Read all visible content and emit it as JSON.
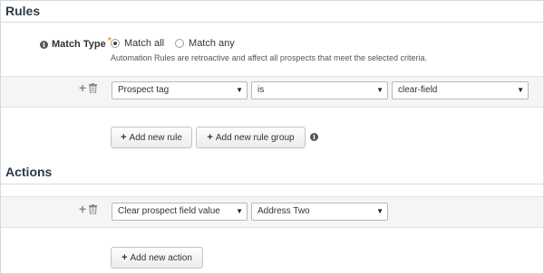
{
  "rules": {
    "title": "Rules",
    "match_type_label": "Match Type",
    "required_marker": "*",
    "options": [
      {
        "label": "Match all",
        "selected": true
      },
      {
        "label": "Match any",
        "selected": false
      }
    ],
    "hint": "Automation Rules are retroactive and affect all prospects that meet the selected criteria.",
    "rule_row": {
      "field": "Prospect tag",
      "operator": "is",
      "value": "clear-field"
    },
    "add_rule_label": "Add new rule",
    "add_group_label": "Add new rule group"
  },
  "actions": {
    "title": "Actions",
    "action_row": {
      "action": "Clear prospect field value",
      "field": "Address Two"
    },
    "add_action_label": "Add new action"
  },
  "icons": {
    "plus": "plus-icon",
    "trash": "trash-icon",
    "info": "info-icon",
    "caret": "caret-down-icon"
  },
  "colors": {
    "title": "#2d3b48",
    "band": "#f5f5f5",
    "required": "#e8a000"
  }
}
